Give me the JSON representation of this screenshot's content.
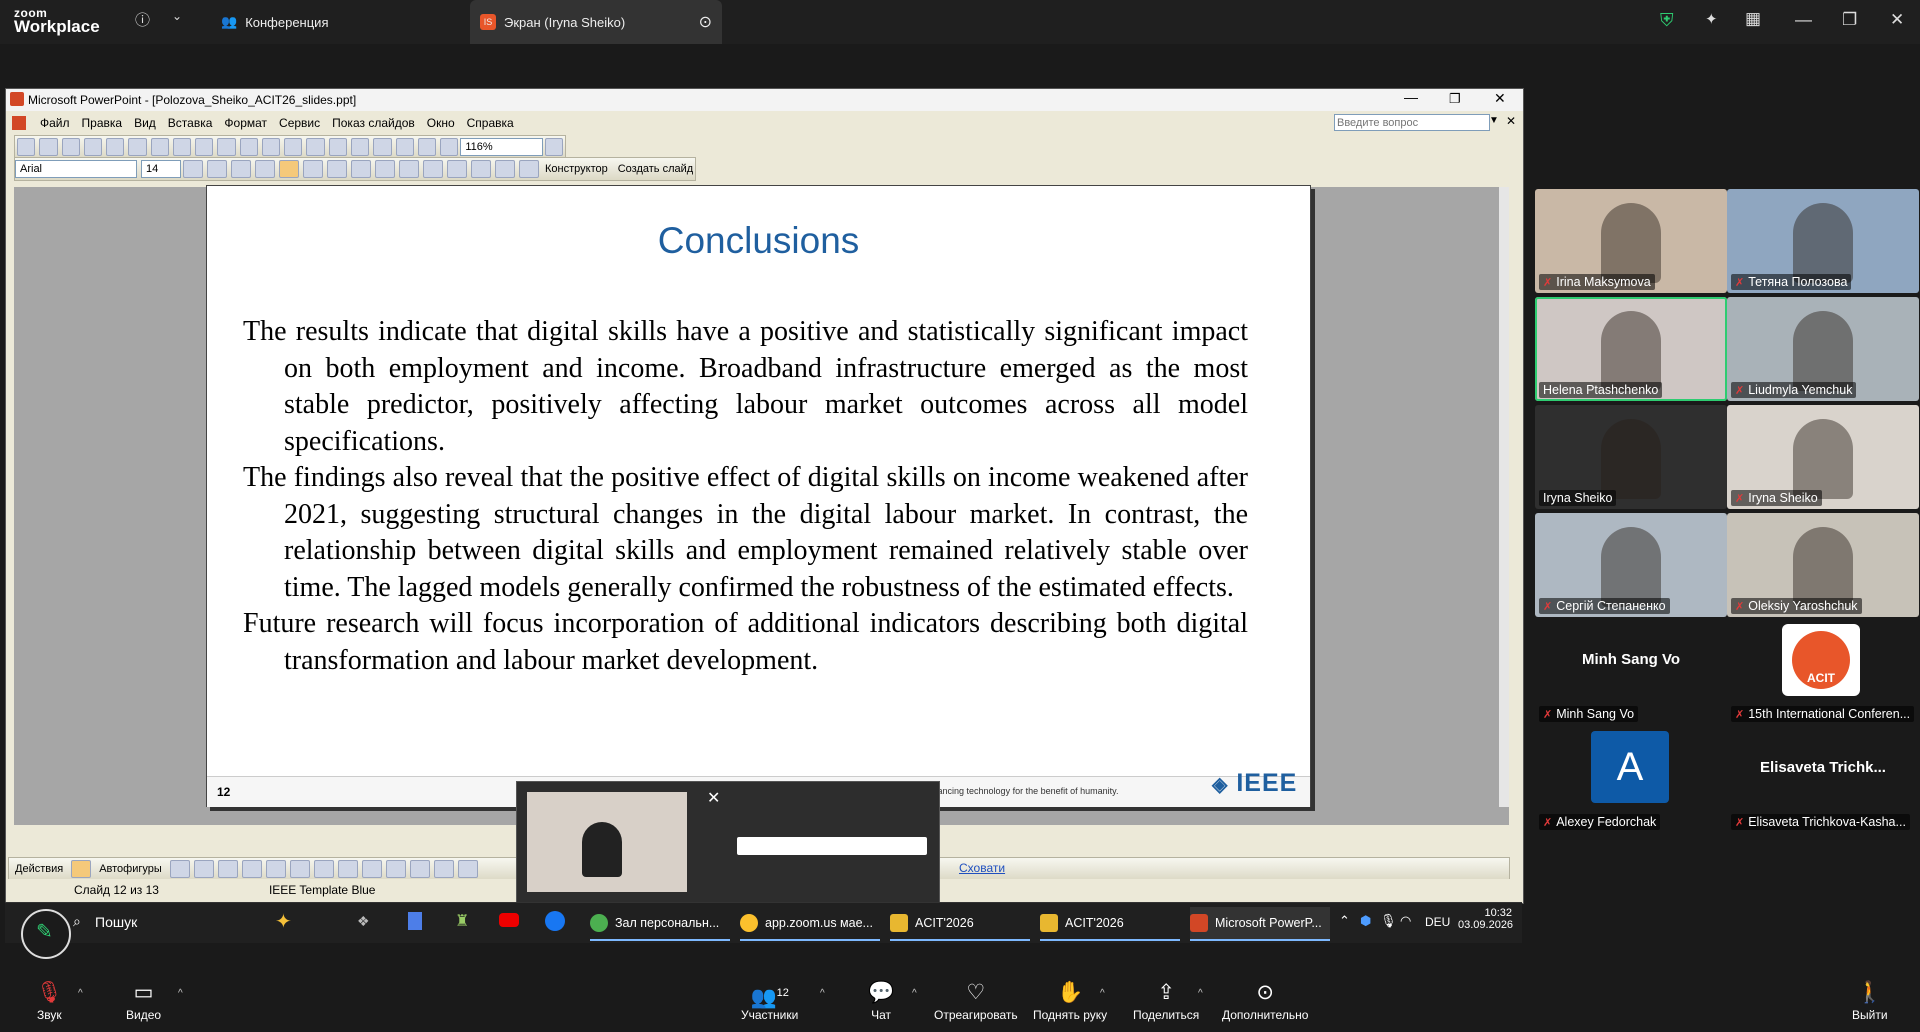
{
  "topbar": {
    "app_line1": "zoom",
    "app_line2": "Workplace",
    "tabs": [
      {
        "label": "Конференция",
        "icon": "people-icon"
      },
      {
        "label": "Экран (Iryna Sheiko)",
        "icon": "share-screen-icon",
        "badge": "IS"
      }
    ]
  },
  "ppt": {
    "window_title": "Microsoft PowerPoint - [Polozova_Sheiko_ACIT26_slides.ppt]",
    "menu": [
      "Файл",
      "Правка",
      "Вид",
      "Вставка",
      "Формат",
      "Сервис",
      "Показ слайдов",
      "Окно",
      "Справка"
    ],
    "help_placeholder": "Введите вопрос",
    "zoom": "116%",
    "font": "Arial",
    "font_size": "14",
    "designer": "Конструктор",
    "new_slide": "Создать слайд",
    "draw_actions": "Действия",
    "autoshapes": "Автофигуры",
    "status_slide": "Слайд 12 из 13",
    "status_template": "IEEE Template Blue",
    "hide": "Сховати",
    "slide": {
      "title": "Conclusions",
      "paragraphs": [
        "The results indicate that digital skills have a positive and statistically significant impact on both employment and income. Broadband infrastructure emerged as the most stable predictor, positively affecting labour market outcomes across all model specifications.",
        "The findings also reveal that the positive effect of digital skills on income weakened after 2021, suggesting structural changes in the digital labour market. In contrast, the relationship between digital skills and employment remained relatively stable over time. The lagged models generally confirmed the robustness of the estimated effects.",
        "Future research will focus incorporation of additional indicators describing both digital transformation and labour market development."
      ],
      "page_number": "12",
      "footer_tagline": "advancing technology for the benefit of humanity.",
      "logo": "IEEE"
    }
  },
  "taskbar": {
    "search": "Пошук",
    "items": [
      {
        "label": "Зал персональн...",
        "color": "#4caf50"
      },
      {
        "label": "app.zoom.us мае...",
        "color": "#fbc02d"
      },
      {
        "label": "ACIT'2026",
        "color": "#e8b730"
      },
      {
        "label": "ACIT'2026",
        "color": "#e8b730"
      },
      {
        "label": "Microsoft PowerP...",
        "color": "#d24726"
      }
    ],
    "lang": "DEU",
    "time": "10:32",
    "date": "03.09.2026"
  },
  "gallery": [
    {
      "name": "Irina Maksymova",
      "bg": "#c9b8a6",
      "muted": true
    },
    {
      "name": "Тетяна Полозова",
      "bg": "#8fa6c0",
      "muted": true
    },
    {
      "name": "Helena Ptashchenko",
      "bg": "#cfc7c4",
      "muted": false,
      "active": true
    },
    {
      "name": "Liudmyla Yemchuk",
      "bg": "#a9b2b8",
      "muted": true
    },
    {
      "name": "Iryna Sheiko",
      "bg": "#2f2f2f",
      "muted": false
    },
    {
      "name": "Iryna Sheiko",
      "bg": "#d9d3cc",
      "muted": true
    },
    {
      "name": "Сергій Степаненко",
      "bg": "#aeb8c2",
      "muted": true
    },
    {
      "name": "Oleksiy Yaroshchuk",
      "bg": "#c7c2b8",
      "muted": true
    },
    {
      "name": "Minh Sang Vo",
      "heading": "Minh Sang Vo",
      "bg": "#1a1a1a",
      "muted": true
    },
    {
      "name": "15th International Conferen...",
      "bg": "#1a1a1a",
      "muted": true,
      "logo": "ACIT"
    },
    {
      "name": "Alexey Fedorchak",
      "bg": "#1a1a1a",
      "muted": true,
      "avatar": "A"
    },
    {
      "name": "Elisaveta Trichkova-Kasha...",
      "heading": "Elisaveta  Trichk...",
      "bg": "#1a1a1a",
      "muted": true
    }
  ],
  "bottombar": {
    "audio": "Звук",
    "video": "Видео",
    "participants": "Участники",
    "participants_count": "12",
    "chat": "Чат",
    "react": "Отреагировать",
    "raise_hand": "Поднять руку",
    "share": "Поделиться",
    "more": "Дополнительно",
    "leave": "Выйти"
  },
  "colors": {
    "accent": "#1f5f9f",
    "active_speaker": "#2ecc71",
    "leave": "#e23a3a"
  }
}
